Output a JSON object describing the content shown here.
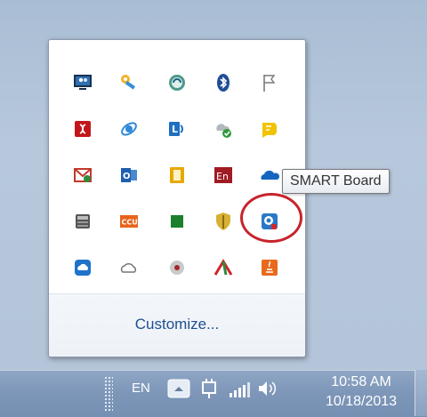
{
  "flyout": {
    "customize_label": "Customize...",
    "icons": [
      [
        "monitor-users-icon",
        "keys-icon",
        "network-globe-icon",
        "bluetooth-icon",
        "flag-icon"
      ],
      [
        "red-app-icon",
        "ie-icon",
        "lync-icon",
        "cloud-sync-check-icon",
        "yellow-chat-icon"
      ],
      [
        "mail-icon",
        "outlook-icon",
        "yellow-app-icon",
        "english-en-icon",
        "onedrive-cloud-icon"
      ],
      [
        "toolkit-icon",
        "ccu-icon",
        "green-square-icon",
        "shield-icon",
        "smart-board-icon"
      ],
      [
        "blue-cloud-icon",
        "outline-cloud-icon",
        "grey-app-icon",
        "red-green-arrow-icon",
        "java-icon"
      ]
    ]
  },
  "tooltip": {
    "text": "SMART Board"
  },
  "taskbar": {
    "language": "EN",
    "time": "10:58 AM",
    "date": "10/18/2013"
  }
}
